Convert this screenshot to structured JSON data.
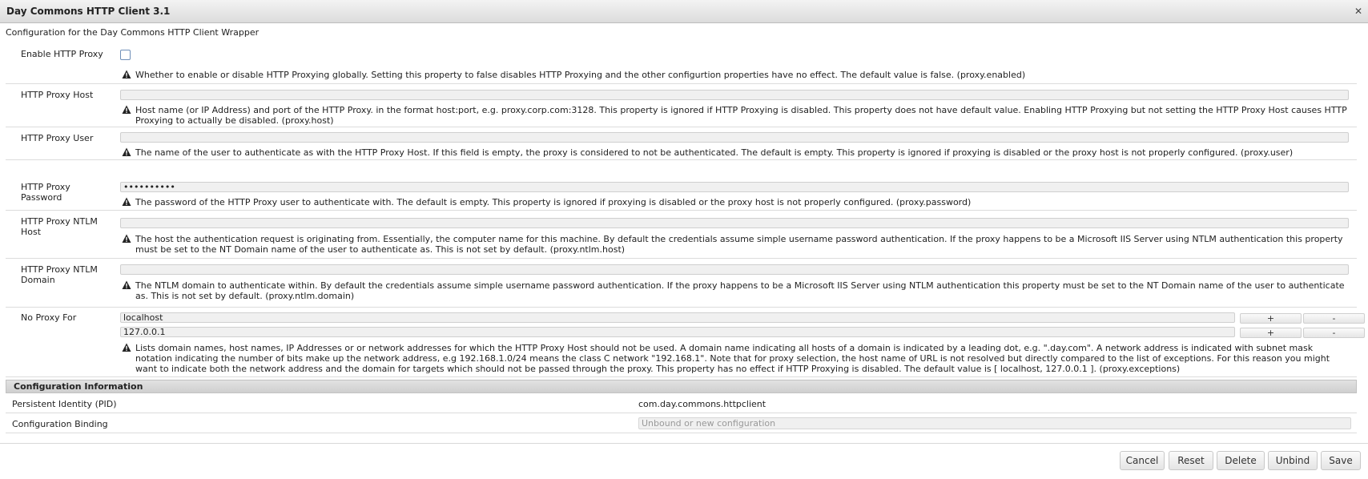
{
  "window": {
    "title": "Day Commons HTTP Client 3.1",
    "description": "Configuration for the Day Commons HTTP Client Wrapper"
  },
  "properties": [
    {
      "label": "Enable HTTP Proxy",
      "type": "checkbox",
      "checked": false,
      "note": "Whether to enable or disable HTTP Proxying globally. Setting this property to false disables HTTP Proxying and the other configurtion properties have no effect. The default value is false. (proxy.enabled)"
    },
    {
      "label": "HTTP Proxy Host",
      "type": "text",
      "value": "",
      "note": "Host name (or IP Address) and port of the HTTP Proxy. in the format host:port, e.g. proxy.corp.com:3128. This property is ignored if HTTP Proxying is disabled. This property does not have default value. Enabling HTTP Proxying but not setting the HTTP Proxy Host causes HTTP Proxying to actually be disabled. (proxy.host)"
    },
    {
      "label": "HTTP Proxy User",
      "type": "text",
      "value": "",
      "note": "The name of the user to authenticate as with the HTTP Proxy Host. If this field is empty, the proxy is considered to not be authenticated. The default is empty. This property is ignored if proxying is disabled or the proxy host is not properly configured. (proxy.user)"
    },
    {
      "label": "HTTP Proxy Password",
      "type": "password",
      "value": "••••••••••",
      "note": "The password of the HTTP Proxy user to authenticate with. The default is empty. This property is ignored if proxying is disabled or the proxy host is not properly configured. (proxy.password)"
    },
    {
      "label": "HTTP Proxy NTLM Host",
      "type": "text",
      "value": "",
      "note": "The host the authentication request is originating from. Essentially, the computer name for this machine. By default the credentials assume simple username password authentication. If the proxy happens to be a Microsoft IIS Server using NTLM authentication this property must be set to the NT Domain name of the user to authenticate as. This is not set by default. (proxy.ntlm.host)"
    },
    {
      "label": "HTTP Proxy NTLM Domain",
      "type": "text",
      "value": "",
      "note": "The NTLM domain to authenticate within. By default the credentials assume simple username password authentication. If the proxy happens to be a Microsoft IIS Server using NTLM authentication this property must be set to the NT Domain name of the user to authenticate as. This is not set by default. (proxy.ntlm.domain)"
    },
    {
      "label": "No Proxy For",
      "type": "multi",
      "values": [
        "localhost",
        "127.0.0.1"
      ],
      "add_label": "+",
      "remove_label": "-",
      "note": "Lists domain names, host names, IP Addresses or or network addresses for which the HTTP Proxy Host should not be used. A domain name indicating all hosts of a domain is indicated by a leading dot, e.g. \".day.com\". A network address is indicated with subnet mask notation indicating the number of bits make up the network address, e.g 192.168.1.0/24 means the class C network \"192.168.1\". Note that for proxy selection, the host name of URL is not resolved but directly compared to the list of exceptions. For this reason you might want to indicate both the network address and the domain for targets which should not be passed through the proxy. This property has no effect if HTTP Proxying is disabled. The default value is [ localhost, 127.0.0.1 ]. (proxy.exceptions)"
    }
  ],
  "config_info": {
    "header": "Configuration Information",
    "pid_label": "Persistent Identity (PID)",
    "pid_value": "com.day.commons.httpclient",
    "binding_label": "Configuration Binding",
    "binding_placeholder": "Unbound or new configuration"
  },
  "actions": {
    "cancel": "Cancel",
    "reset": "Reset",
    "delete": "Delete",
    "unbind": "Unbind",
    "save": "Save"
  },
  "icons": {
    "close": "close-icon",
    "warning": "warning-icon"
  }
}
